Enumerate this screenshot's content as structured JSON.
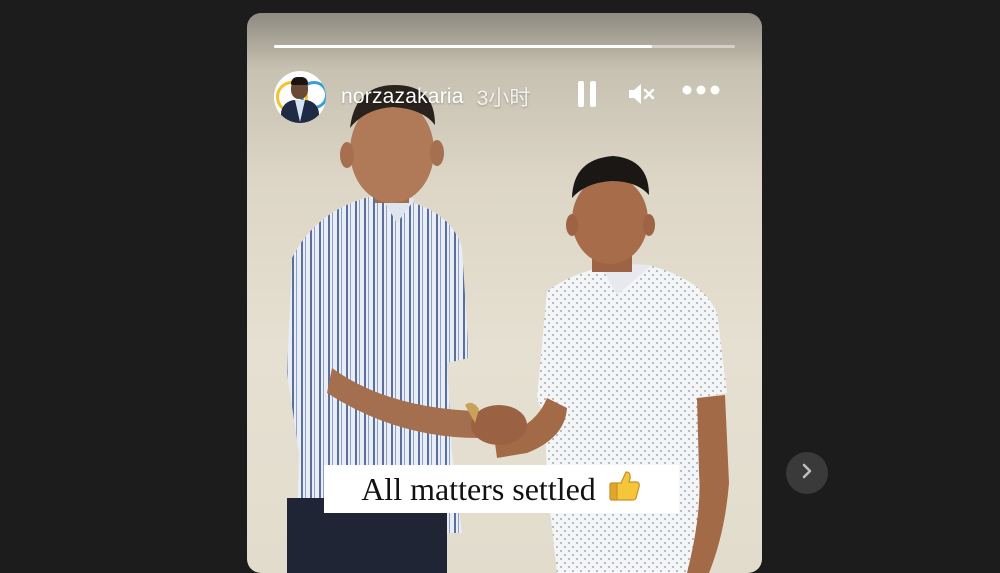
{
  "story": {
    "progress": 0.82,
    "username": "norzazakaria",
    "time": "3小时",
    "caption": "All matters settled",
    "caption_emoji": "thumbs-up",
    "controls": [
      "pause-icon",
      "mute-icon",
      "more-icon"
    ]
  },
  "navigation": {
    "next_icon": "chevron-right-icon"
  },
  "colors": {
    "page_background": "#1c1c1c",
    "progress_fill": "#ffffff",
    "next_button": "#3a3a3a"
  }
}
